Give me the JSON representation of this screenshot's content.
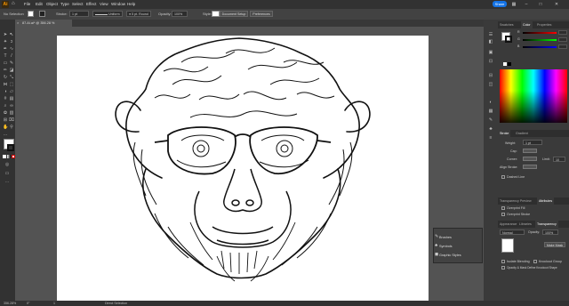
{
  "menubar": {
    "app_icon": "Ai",
    "items": [
      "File",
      "Edit",
      "Object",
      "Type",
      "Select",
      "Effect",
      "View",
      "Window",
      "Help"
    ],
    "share_label": "Share"
  },
  "controlbar": {
    "selection_label": "No Selection",
    "stroke_label": "Stroke:",
    "stroke_value": "1 pt",
    "brush_label": "Uniform",
    "round_label": "5 pt. Round",
    "opacity_label": "Opacity:",
    "opacity_value": "100%",
    "style_label": "Style:",
    "doc_setup": "Document Setup",
    "preferences": "Preferences"
  },
  "document_tab": {
    "title": "87.AI.ai* @ 356.28 % (RGB/Preview)"
  },
  "status": {
    "zoom": "356.28%",
    "angle": "0°",
    "page": "1",
    "tool": "Direct Selection"
  },
  "panels": {
    "top_tabs": [
      "Swatches",
      "Color",
      "Properties"
    ],
    "stroke_tabs": [
      "Stroke",
      "Gradient"
    ],
    "weight_label": "Weight:",
    "weight_value": "1 pt",
    "cap_label": "Cap:",
    "corner_label": "Corner:",
    "limit_label": "Limit:",
    "limit_value": "10",
    "align_label": "Align Stroke:",
    "dashed_label": "Dashed Line",
    "attr_tabs": [
      "Transparency Preview",
      "Attributes"
    ],
    "overprint_fill": "Overprint Fill",
    "overprint_stroke": "Overprint Stroke",
    "trans_tabs": [
      "Appearance",
      "Libraries",
      "Transparency"
    ],
    "blend_mode": "Normal",
    "opacity_label": "Opacity:",
    "opacity_value": "100%",
    "make_mask": "Make Mask",
    "isolate": "Isolate Blending",
    "knockout": "Knockout Group",
    "opacity_mask": "Opacity & Mask Define Knockout Shape"
  },
  "float_panel": {
    "items": [
      "Brushes",
      "Symbols",
      "Graphic Styles"
    ]
  },
  "colors": {
    "accent": "#1473e6",
    "ai_orange": "#ff9a00"
  }
}
